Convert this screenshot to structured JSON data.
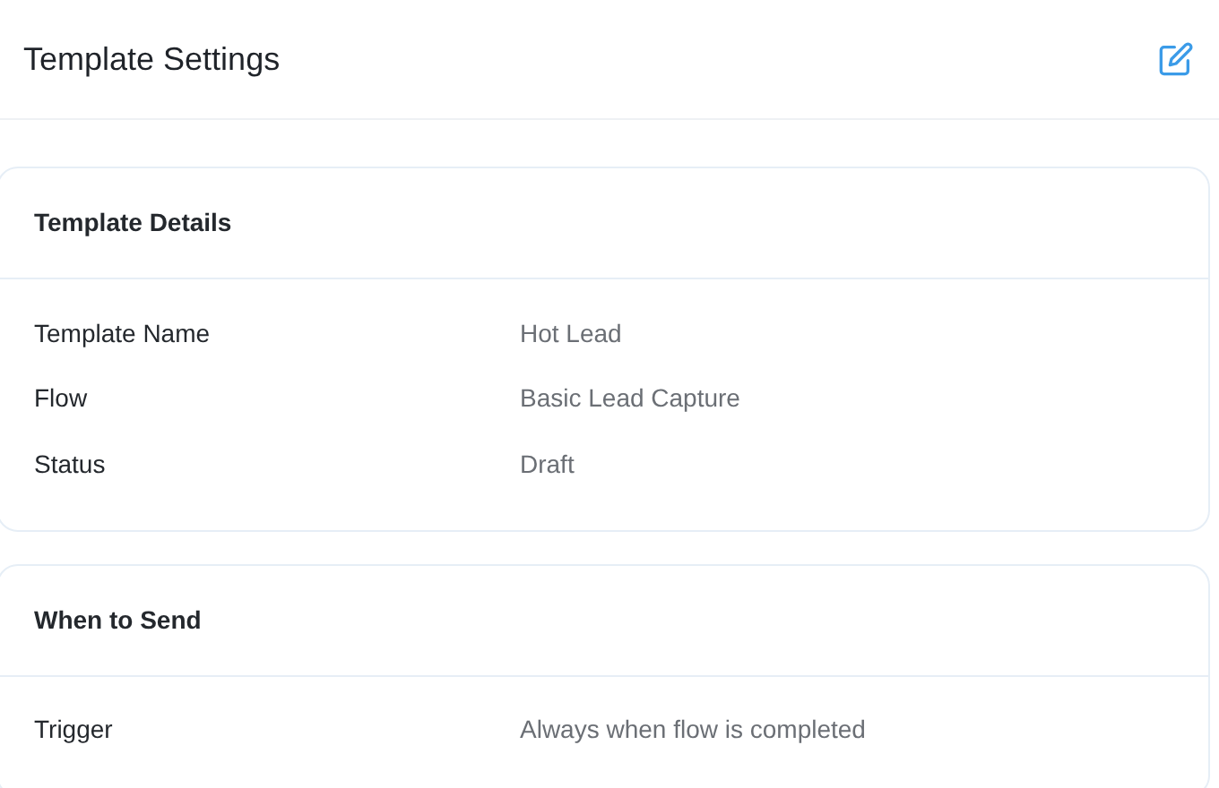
{
  "header": {
    "title": "Template Settings"
  },
  "sections": [
    {
      "title": "Template Details",
      "rows": [
        {
          "label": "Template Name",
          "value": "Hot Lead"
        },
        {
          "label": "Flow",
          "value": "Basic Lead Capture"
        },
        {
          "label": "Status",
          "value": "Draft"
        }
      ]
    },
    {
      "title": "When to Send",
      "rows": [
        {
          "label": "Trigger",
          "value": "Always when flow is completed"
        }
      ]
    }
  ]
}
